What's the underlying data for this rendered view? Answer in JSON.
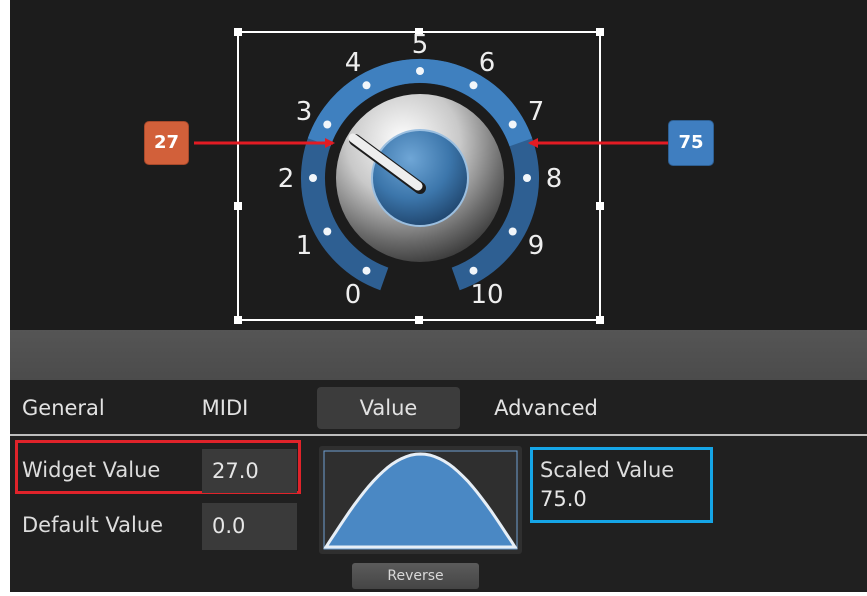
{
  "knob": {
    "scale_labels": [
      "0",
      "1",
      "2",
      "3",
      "4",
      "5",
      "6",
      "7",
      "8",
      "9",
      "10"
    ],
    "current_level": 3,
    "min_marker": "27",
    "max_marker": "75"
  },
  "tabs": {
    "general": "General",
    "midi": "MIDI",
    "value": "Value",
    "advanced": "Advanced"
  },
  "value_tab": {
    "widget_value_label": "Widget Value",
    "widget_value": "27.0",
    "default_value_label": "Default Value",
    "default_value": "0.0",
    "scaled_value_label": "Scaled Value",
    "scaled_value": "75.0",
    "reverse_label": "Reverse"
  },
  "colors": {
    "min_marker": "#d2603a",
    "max_marker": "#3f7ec0",
    "widget_value_highlight": "#e0232a",
    "scaled_value_highlight": "#15a5e6",
    "knob_ring": "#3a78b4",
    "curve_fill": "#4a88c4"
  }
}
